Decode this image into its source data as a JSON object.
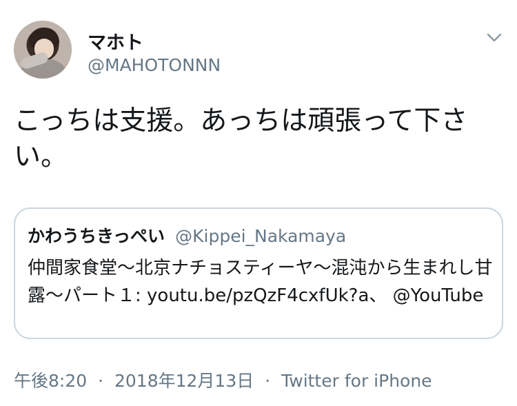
{
  "tweet": {
    "author": {
      "display_name": "マホト",
      "handle": "@MAHOTONNN",
      "avatar": "profile-photo"
    },
    "text": "こっちは支援。あっちは頑張って下さい。",
    "quoted": {
      "display_name": "かわうちきっぺい",
      "handle": "@Kippei_Nakamaya",
      "text": "仲間家食堂〜北京ナチョスティーヤ〜混沌から生まれし甘露〜パート１: youtu.be/pzQzF4cxfUk?a、 @YouTube"
    },
    "meta": {
      "time": "午後8:20",
      "separator": "·",
      "date": "2018年12月13日",
      "source": "Twitter for iPhone"
    }
  },
  "icons": {
    "more": "chevron-down-icon"
  },
  "colors": {
    "text": "#14171a",
    "secondary": "#657786",
    "border": "#ccd6dd"
  }
}
